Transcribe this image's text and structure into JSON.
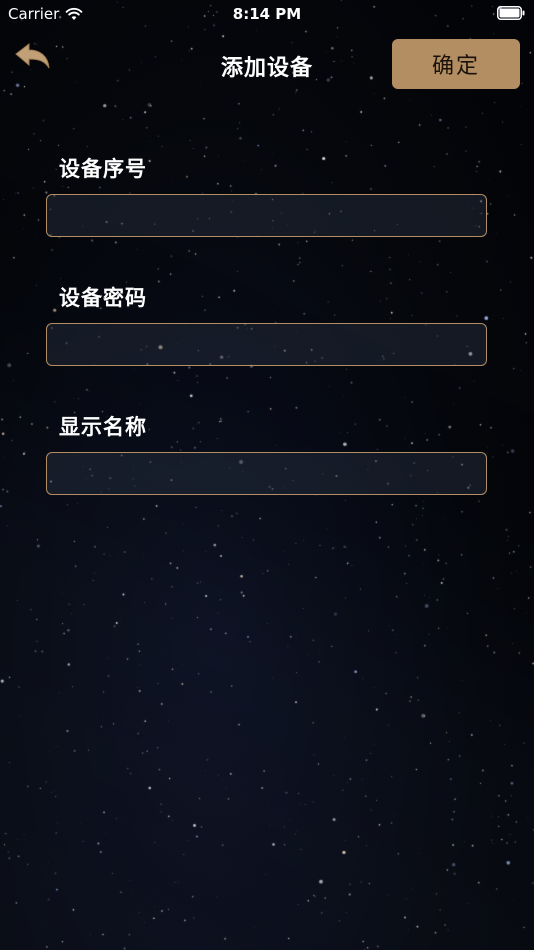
{
  "status_bar": {
    "carrier": "Carrier",
    "time": "8:14 PM",
    "wifi_icon": "wifi-icon",
    "battery_icon": "battery-icon"
  },
  "nav": {
    "title": "添加设备",
    "back_icon": "back-arrow-icon",
    "confirm_label": "确定"
  },
  "form": {
    "fields": [
      {
        "label": "设备序号",
        "value": "",
        "placeholder": ""
      },
      {
        "label": "设备密码",
        "value": "",
        "placeholder": ""
      },
      {
        "label": "显示名称",
        "value": "",
        "placeholder": ""
      }
    ]
  },
  "colors": {
    "accent": "#b48e63",
    "background": "#05070c",
    "text": "#ffffff"
  }
}
